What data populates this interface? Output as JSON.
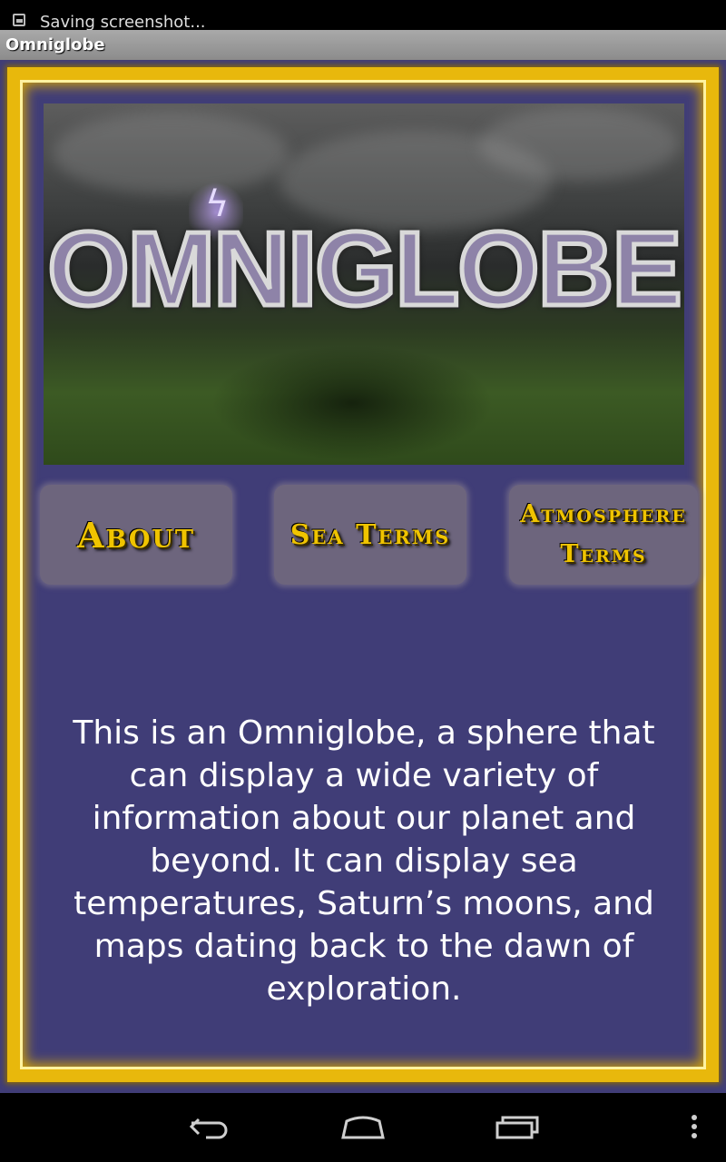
{
  "status_bar": {
    "notification": "Saving screenshot..."
  },
  "app": {
    "title": "Omniglobe"
  },
  "banner": {
    "logo_text": "OMNIGLOBE"
  },
  "buttons": {
    "about": "About",
    "sea_terms": "Sea Terms",
    "atmosphere_line1": "Atmosphere",
    "atmosphere_line2": "Terms"
  },
  "description": "This is an Omniglobe, a sphere that can display a wide variety of information about our planet and beyond. It can display sea temperatures, Saturn’s moons, and maps dating back to the dawn of exploration.",
  "colors": {
    "background": "#403d77",
    "frame": "#e8b80c",
    "button_text": "#f0c400",
    "button_bg": "#6d657d"
  },
  "nav_icons": [
    "back-icon",
    "home-icon",
    "recent-apps-icon",
    "overflow-menu-icon"
  ]
}
